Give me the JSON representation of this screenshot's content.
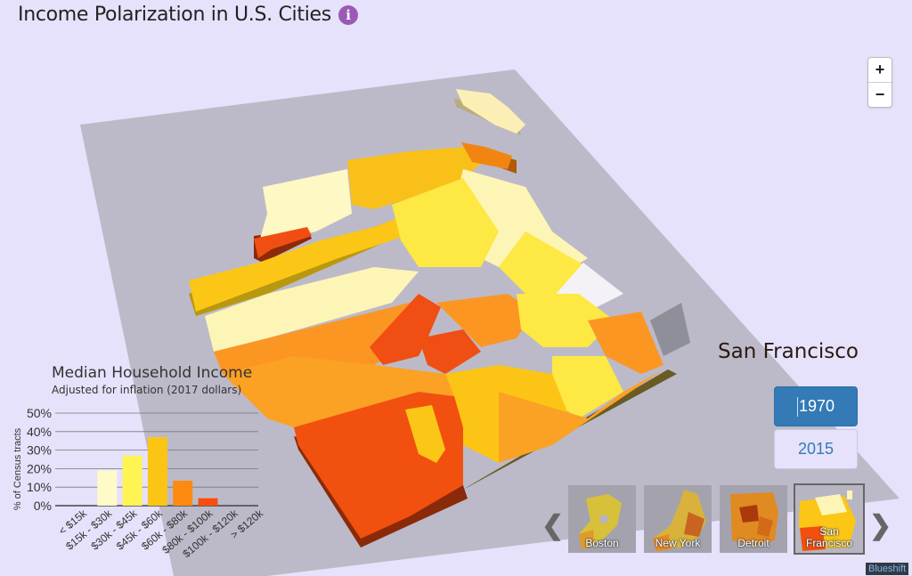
{
  "header": {
    "title": "Income Polarization in U.S. Cities",
    "info_icon": "info-circle-icon"
  },
  "zoom_controls": {
    "zoom_in": "+",
    "zoom_out": "−"
  },
  "city": {
    "name": "San Francisco"
  },
  "years": {
    "options": [
      "1970",
      "2015"
    ],
    "selected": "1970"
  },
  "legend": {
    "title": "Median Household Income",
    "subtitle": "Adjusted for inflation (2017 dollars)",
    "colors": {
      "lt15": "#fffbe6",
      "15to30": "#fffbc8",
      "30to45": "#fff453",
      "45to60": "#fcc516",
      "60to80": "#ff8a12",
      "80to100": "#fa4d0d",
      "100to120": "#c1290b",
      "gt120": "#7a1a08"
    }
  },
  "chart_data": {
    "type": "bar",
    "title": "Median Household Income",
    "subtitle": "Adjusted for inflation (2017 dollars)",
    "xlabel": "",
    "ylabel": "% of Census tracts",
    "categories": [
      "< $15k",
      "$15k - $30k",
      "$30k - $45k",
      "$45k - $60k",
      "$60k - $80k",
      "$80k - $100k",
      "$100k - $120k",
      "> $120k"
    ],
    "values": [
      0,
      19,
      27,
      37,
      13.5,
      4,
      0,
      0
    ],
    "bar_colors": [
      "#fffbe6",
      "#fffbc8",
      "#fff453",
      "#fcc516",
      "#ff8a12",
      "#fa4d0d",
      "#c1290b",
      "#7a1a08"
    ],
    "yticks": [
      "0%",
      "10%",
      "20%",
      "30%",
      "40%",
      "50%"
    ],
    "ylim": [
      0,
      50
    ],
    "grid": true
  },
  "carousel": {
    "prev_icon": "chevron-left-icon",
    "next_icon": "chevron-right-icon",
    "cities": [
      {
        "label": "Boston",
        "selected": false
      },
      {
        "label": "New York",
        "selected": false
      },
      {
        "label": "Detroit",
        "selected": false
      },
      {
        "label": "San Francisco",
        "selected": true
      }
    ]
  },
  "footer": {
    "brand": "Blueshift"
  }
}
